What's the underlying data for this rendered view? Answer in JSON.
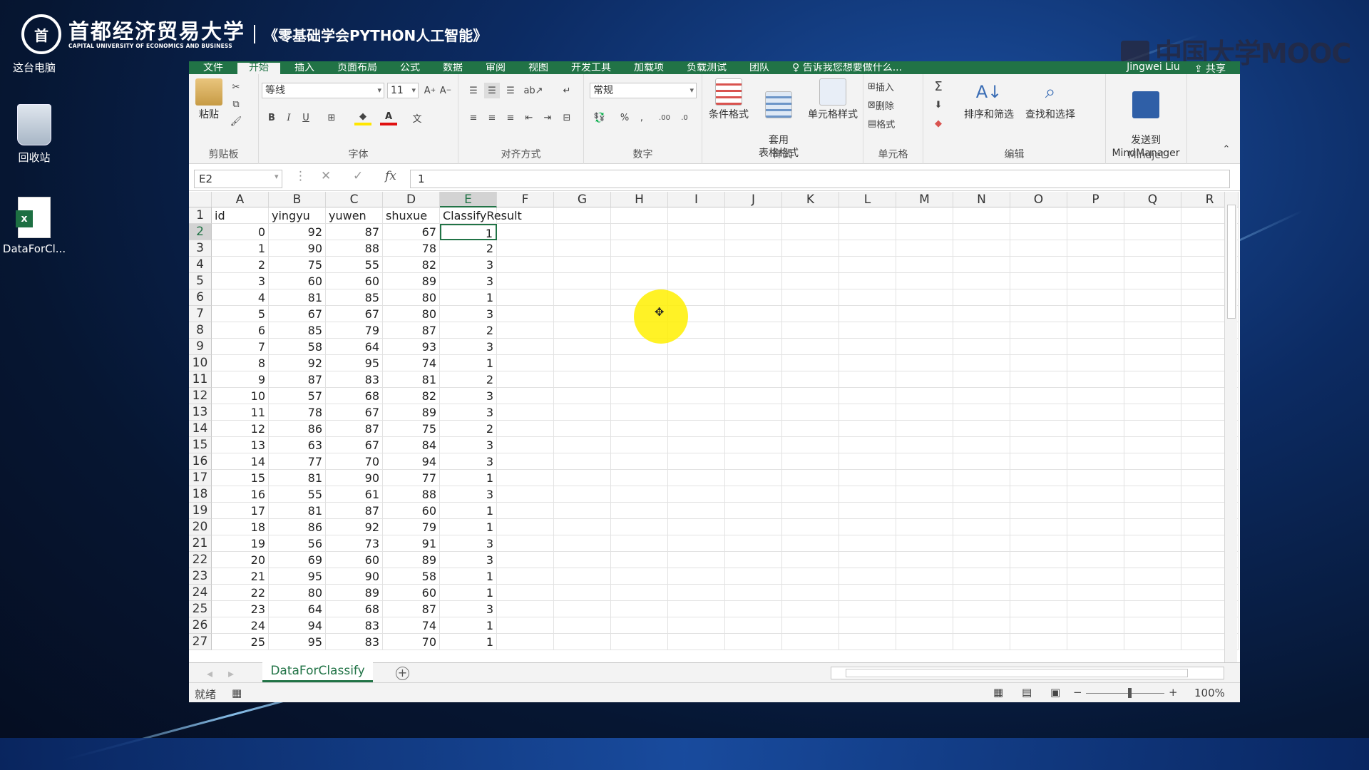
{
  "banner": {
    "seal_char": "首",
    "university_cn": "首都经济贸易大学",
    "university_en": "CAPITAL UNIVERSITY OF ECONOMICS AND BUSINESS",
    "course_title": "《零基础学会PYTHON人工智能》",
    "watermark": "中国大学MOOC"
  },
  "desktop": {
    "icons": [
      {
        "label": "这台电脑"
      },
      {
        "label": "回收站"
      },
      {
        "label": "DataForCl..."
      }
    ]
  },
  "excel": {
    "ribbon_tabs": [
      "文件",
      "开始",
      "插入",
      "页面布局",
      "公式",
      "数据",
      "审阅",
      "视图",
      "开发工具",
      "加载项",
      "负载测试",
      "团队",
      "♀ 告诉我您想要做什么..."
    ],
    "active_tab": "开始",
    "user": "Jingwei Liu",
    "share": "共享",
    "groups": {
      "clipboard": {
        "label": "剪贴板",
        "paste": "粘贴"
      },
      "font": {
        "label": "字体",
        "font_name": "等线",
        "font_size": "11"
      },
      "alignment": {
        "label": "对齐方式"
      },
      "number": {
        "label": "数字",
        "format": "常规"
      },
      "styles": {
        "label": "样式",
        "cond_format": "条件格式",
        "table_format": "套用\n表格格式",
        "cell_styles": "单元格样式"
      },
      "cells": {
        "label": "单元格",
        "insert": "插入",
        "delete": "删除",
        "format": "格式"
      },
      "editing": {
        "label": "编辑",
        "sort_filter": "排序和筛选",
        "find_select": "查找和选择"
      },
      "mindjet": {
        "label": "Mindjet",
        "send": "发送到\nMindManager"
      }
    },
    "name_box": "E2",
    "formula": "1",
    "columns": [
      "A",
      "B",
      "C",
      "D",
      "E",
      "F",
      "G",
      "H",
      "I",
      "J",
      "K",
      "L",
      "M",
      "N",
      "O",
      "P",
      "Q",
      "R"
    ],
    "selected_column": "E",
    "selected_row": "2",
    "headers": [
      "id",
      "yingyu",
      "yuwen",
      "shuxue",
      "ClassifyResult"
    ],
    "rows": [
      [
        "0",
        "92",
        "87",
        "67",
        "1"
      ],
      [
        "1",
        "90",
        "88",
        "78",
        "2"
      ],
      [
        "2",
        "75",
        "55",
        "82",
        "3"
      ],
      [
        "3",
        "60",
        "60",
        "89",
        "3"
      ],
      [
        "4",
        "81",
        "85",
        "80",
        "1"
      ],
      [
        "5",
        "67",
        "67",
        "80",
        "3"
      ],
      [
        "6",
        "85",
        "79",
        "87",
        "2"
      ],
      [
        "7",
        "58",
        "64",
        "93",
        "3"
      ],
      [
        "8",
        "92",
        "95",
        "74",
        "1"
      ],
      [
        "9",
        "87",
        "83",
        "81",
        "2"
      ],
      [
        "10",
        "57",
        "68",
        "82",
        "3"
      ],
      [
        "11",
        "78",
        "67",
        "89",
        "3"
      ],
      [
        "12",
        "86",
        "87",
        "75",
        "2"
      ],
      [
        "13",
        "63",
        "67",
        "84",
        "3"
      ],
      [
        "14",
        "77",
        "70",
        "94",
        "3"
      ],
      [
        "15",
        "81",
        "90",
        "77",
        "1"
      ],
      [
        "16",
        "55",
        "61",
        "88",
        "3"
      ],
      [
        "17",
        "81",
        "87",
        "60",
        "1"
      ],
      [
        "18",
        "86",
        "92",
        "79",
        "1"
      ],
      [
        "19",
        "56",
        "73",
        "91",
        "3"
      ],
      [
        "20",
        "69",
        "60",
        "89",
        "3"
      ],
      [
        "21",
        "95",
        "90",
        "58",
        "1"
      ],
      [
        "22",
        "80",
        "89",
        "60",
        "1"
      ],
      [
        "23",
        "64",
        "68",
        "87",
        "3"
      ],
      [
        "24",
        "94",
        "83",
        "74",
        "1"
      ],
      [
        "25",
        "95",
        "83",
        "70",
        "1"
      ]
    ],
    "sheet_tab": "DataForClassify",
    "status_ready": "就绪",
    "zoom": "100%"
  }
}
